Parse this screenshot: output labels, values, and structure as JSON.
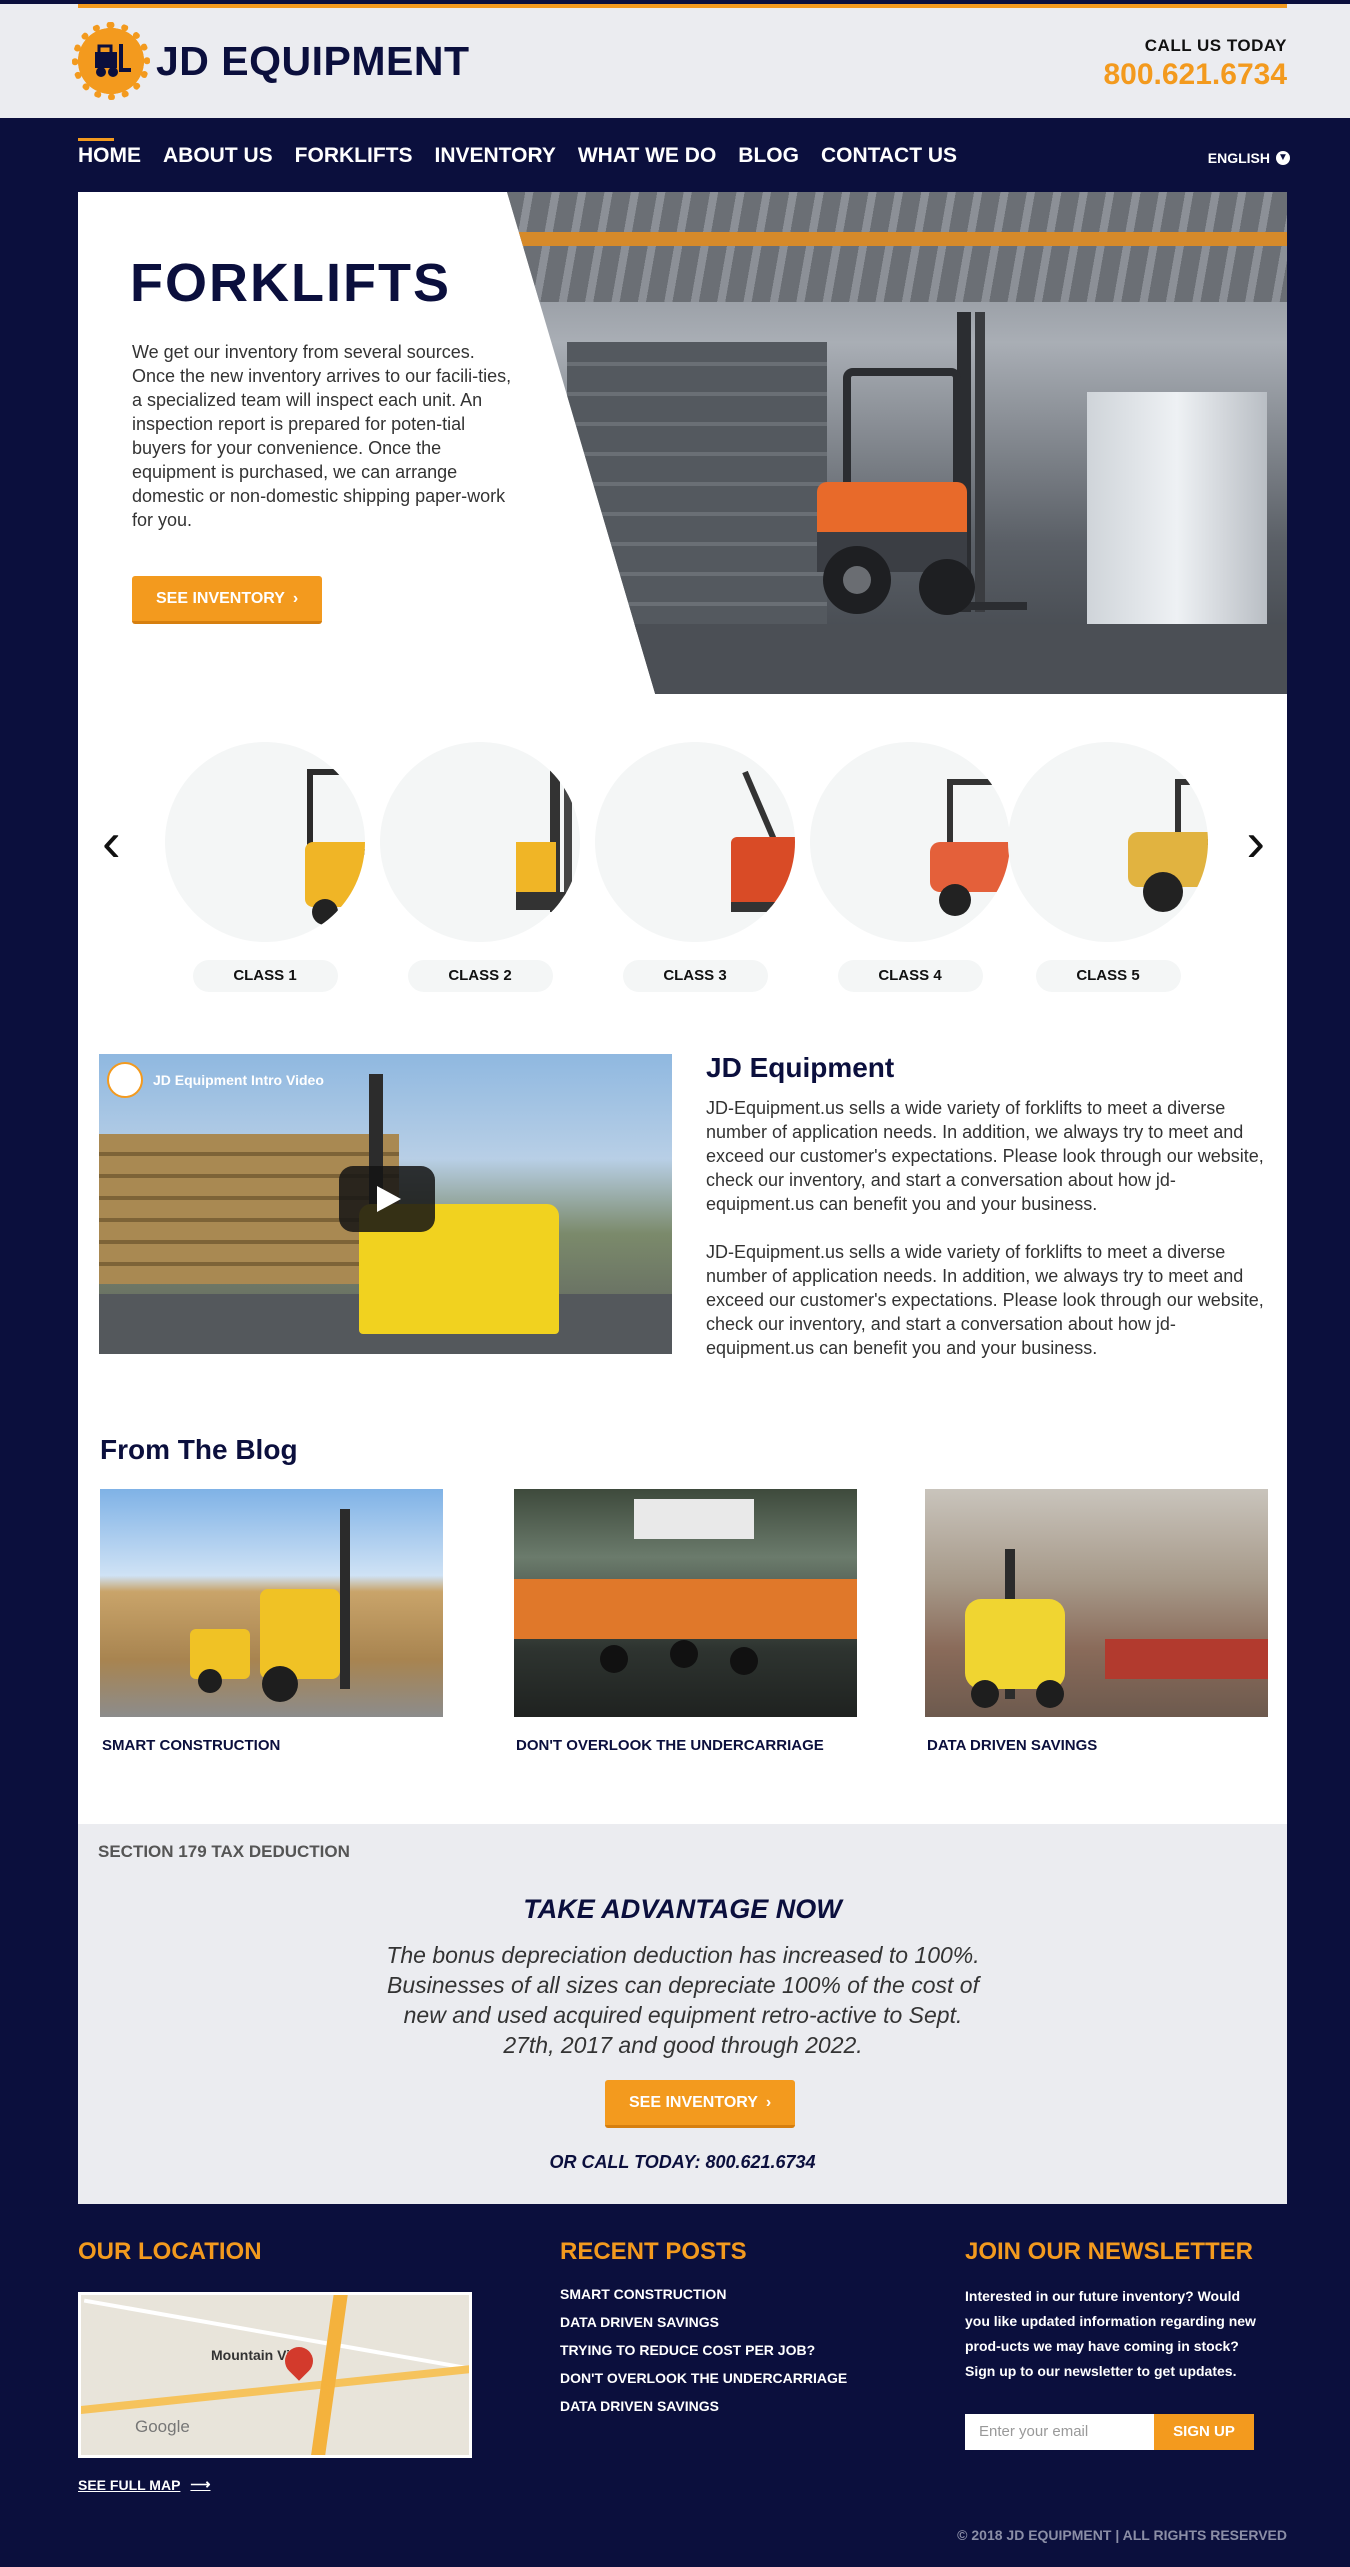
{
  "header": {
    "logo_text": "JD EQUIPMENT",
    "call_label": "CALL US TODAY",
    "phone": "800.621.6734"
  },
  "nav": {
    "items": [
      "HOME",
      "ABOUT US",
      "FORKLIFTS",
      "INVENTORY",
      "WHAT WE DO",
      "BLOG",
      "CONTACT US"
    ],
    "active": "HOME",
    "language": "ENGLISH"
  },
  "hero": {
    "title": "FORKLIFTS",
    "body": "We get our inventory from several sources. Once the new inventory arrives to our facili-ties, a specialized team will inspect each unit. An inspection report is prepared for poten-tial buyers for your convenience. Once the equipment is purchased, we can arrange domestic or non-domestic shipping paper-work for you.",
    "button": "SEE INVENTORY"
  },
  "classes": [
    "CLASS 1",
    "CLASS 2",
    "CLASS 3",
    "CLASS 4",
    "CLASS 5"
  ],
  "video": {
    "title": "JD Equipment Intro Video"
  },
  "about": {
    "title": "JD Equipment",
    "paragraphs": [
      "JD-Equipment.us sells a wide variety of forklifts to meet a diverse number of application needs. In addition, we always try to meet and exceed our customer's expectations. Please look through our website, check our inventory, and start a conversation about how jd-equipment.us can benefit you and your business.",
      "JD-Equipment.us sells a wide variety of forklifts to meet a diverse number of application needs. In addition, we always try to meet and exceed our customer's expectations. Please look through our website, check our inventory, and start a conversation about how jd-equipment.us can benefit you and your business."
    ]
  },
  "blog": {
    "title": "From The Blog",
    "posts": [
      "SMART CONSTRUCTION",
      "DON'T OVERLOOK THE UNDERCARRIAGE",
      "DATA DRIVEN SAVINGS"
    ]
  },
  "tax": {
    "label": "SECTION 179 TAX DEDUCTION",
    "heading": "TAKE ADVANTAGE NOW",
    "body": "The bonus depreciation deduction has increased to 100%. Businesses of all sizes can depreciate 100% of the cost of new and used acquired equipment retro-active to Sept. 27th, 2017 and good through 2022.",
    "button": "SEE INVENTORY",
    "call": "OR CALL TODAY: 800.621.6734"
  },
  "footer": {
    "location_title": "OUR LOCATION",
    "map_town": "Mountain View",
    "map_google": "Google",
    "full_map": "SEE FULL MAP",
    "recent_title": "RECENT POSTS",
    "recent_posts": [
      "SMART CONSTRUCTION",
      "DATA DRIVEN SAVINGS",
      "TRYING TO REDUCE COST PER JOB?",
      "DON'T OVERLOOK THE UNDERCARRIAGE",
      "DATA DRIVEN SAVINGS"
    ],
    "newsletter_title": "JOIN OUR NEWSLETTER",
    "newsletter_text": "Interested in our future inventory? Would you like updated  information regarding new prod-ucts we may have coming in stock? Sign up to our newsletter to get updates.",
    "email_placeholder": "Enter your email",
    "signup": "SIGN UP",
    "copyright": "© 2018 JD EQUIPMENT | ALL RIGHTS RESERVED"
  },
  "colors": {
    "navy": "#0b0f3d",
    "orange": "#f39a1e",
    "light_gray": "#ebecf0"
  },
  "icons": {
    "logo": "gear-forklift-icon",
    "language": "chevron-down-icon",
    "carousel_prev": "chevron-left-icon",
    "carousel_next": "chevron-right-icon",
    "button_arrow": "chevron-right-icon",
    "video": "play-icon",
    "map_pin": "map-pin-icon",
    "full_map": "arrow-right-icon"
  }
}
